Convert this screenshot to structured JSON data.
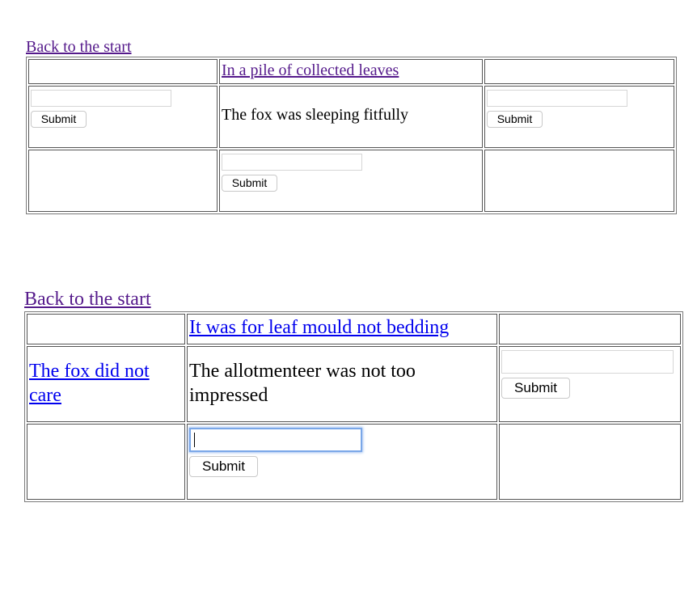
{
  "colors": {
    "visited_link": "#551a8b",
    "unvisited_link": "#0000ee",
    "focus_ring": "#7aa7e8"
  },
  "section1": {
    "back_link": "Back to the start",
    "row1": {
      "col2_link": "In a pile of collected leaves"
    },
    "row2": {
      "col1_input_value": "",
      "col1_submit": "Submit",
      "col2_text": "The fox was sleeping fitfully",
      "col3_input_value": "",
      "col3_submit": "Submit"
    },
    "row3": {
      "col2_input_value": "",
      "col2_submit": "Submit"
    }
  },
  "section2": {
    "back_link": "Back to the start",
    "row1": {
      "col2_link": "It was for leaf mould not bedding"
    },
    "row2": {
      "col1_link": "The fox did not care",
      "col2_text": "The allotmenteer was not too impressed",
      "col3_input_value": "",
      "col3_submit": "Submit"
    },
    "row3": {
      "col2_input_value": "",
      "col2_submit": "Submit"
    }
  }
}
